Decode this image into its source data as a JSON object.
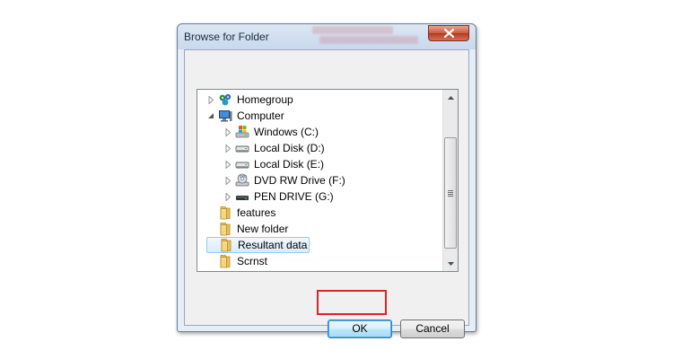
{
  "dialog": {
    "title": "Browse for Folder",
    "close_label": "×"
  },
  "tree": {
    "items": [
      {
        "label": "Homegroup",
        "icon": "homegroup-icon",
        "expander": "collapsed"
      },
      {
        "label": "Computer",
        "icon": "computer-icon",
        "expander": "expanded"
      },
      {
        "label": "Windows (C:)",
        "icon": "windows-drive-icon",
        "expander": "collapsed"
      },
      {
        "label": "Local Disk (D:)",
        "icon": "hard-drive-icon",
        "expander": "collapsed"
      },
      {
        "label": "Local Disk (E:)",
        "icon": "hard-drive-icon",
        "expander": "collapsed"
      },
      {
        "label": "DVD RW Drive (F:)",
        "icon": "dvd-drive-icon",
        "expander": "collapsed"
      },
      {
        "label": "PEN DRIVE (G:)",
        "icon": "usb-drive-icon",
        "expander": "collapsed"
      },
      {
        "label": "features",
        "icon": "folder-icon",
        "expander": "none"
      },
      {
        "label": "New folder",
        "icon": "folder-icon",
        "expander": "none"
      },
      {
        "label": "Resultant data",
        "icon": "folder-icon",
        "expander": "none",
        "selected": true
      },
      {
        "label": "Scrnst",
        "icon": "folder-icon",
        "expander": "none"
      }
    ]
  },
  "buttons": {
    "ok_label": "OK",
    "cancel_label": "Cancel"
  },
  "colors": {
    "highlight": "#e0222a",
    "selection_border": "#99c9ef"
  }
}
